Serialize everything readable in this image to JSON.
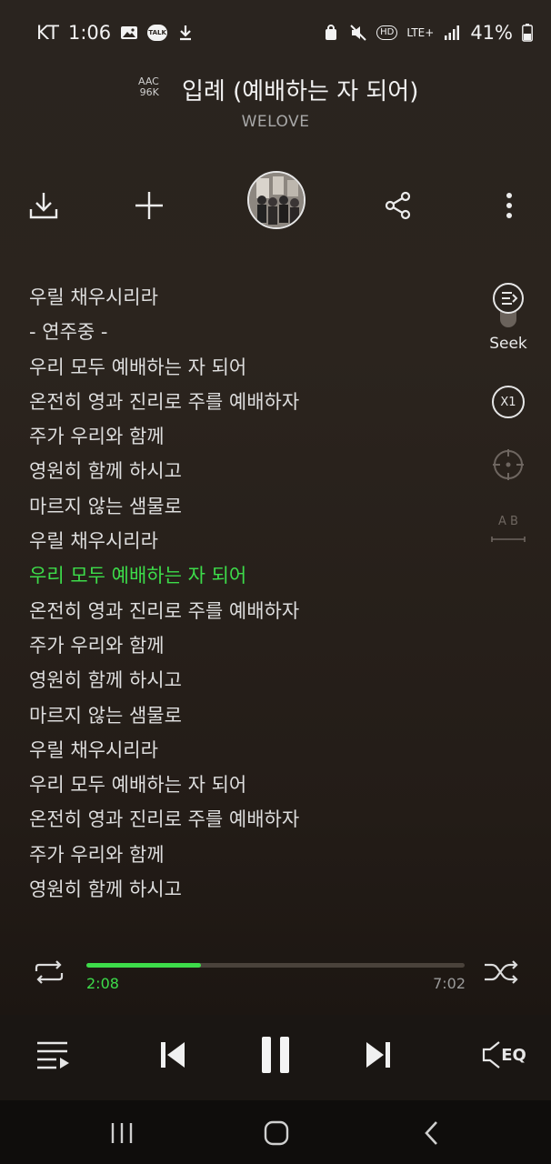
{
  "status": {
    "carrier": "KT",
    "time": "1:06",
    "battery": "41%",
    "talk_badge": "TALK",
    "network": "LTE+"
  },
  "header": {
    "codec": "AAC",
    "bitrate": "96K",
    "title": "입례 (예배하는 자 되어)",
    "artist": "WELOVE"
  },
  "toolbar": {
    "download": "download-icon",
    "add": "plus-icon",
    "share": "share-icon",
    "more": "more-vertical-icon"
  },
  "lyrics": [
    {
      "text": "우릴 채우시리라",
      "active": false
    },
    {
      "text": "- 연주중 -",
      "active": false
    },
    {
      "text": "우리 모두 예배하는 자 되어",
      "active": false
    },
    {
      "text": "온전히 영과 진리로 주를 예배하자",
      "active": false
    },
    {
      "text": "주가 우리와 함께",
      "active": false
    },
    {
      "text": "영원히 함께 하시고",
      "active": false
    },
    {
      "text": "마르지 않는 샘물로",
      "active": false
    },
    {
      "text": "우릴 채우시리라",
      "active": false
    },
    {
      "text": "우리 모두 예배하는 자 되어",
      "active": true
    },
    {
      "text": "온전히 영과 진리로 주를 예배하자",
      "active": false
    },
    {
      "text": "주가 우리와 함께",
      "active": false
    },
    {
      "text": "영원히 함께 하시고",
      "active": false
    },
    {
      "text": "마르지 않는 샘물로",
      "active": false
    },
    {
      "text": "우릴 채우시리라",
      "active": false
    },
    {
      "text": "우리 모두 예배하는 자 되어",
      "active": false
    },
    {
      "text": "온전히 영과 진리로 주를 예배하자",
      "active": false
    },
    {
      "text": "주가 우리와 함께",
      "active": false
    },
    {
      "text": "영원히 함께 하시고",
      "active": false
    }
  ],
  "side": {
    "seek_label": "Seek",
    "speed_label": "X1",
    "ab_label": "A B"
  },
  "progress": {
    "current": "2:08",
    "total": "7:02",
    "fraction": 0.303
  },
  "controls": {
    "eq_label": "EQ"
  },
  "colors": {
    "accent": "#3ddc4a",
    "background": "#2a241f"
  }
}
